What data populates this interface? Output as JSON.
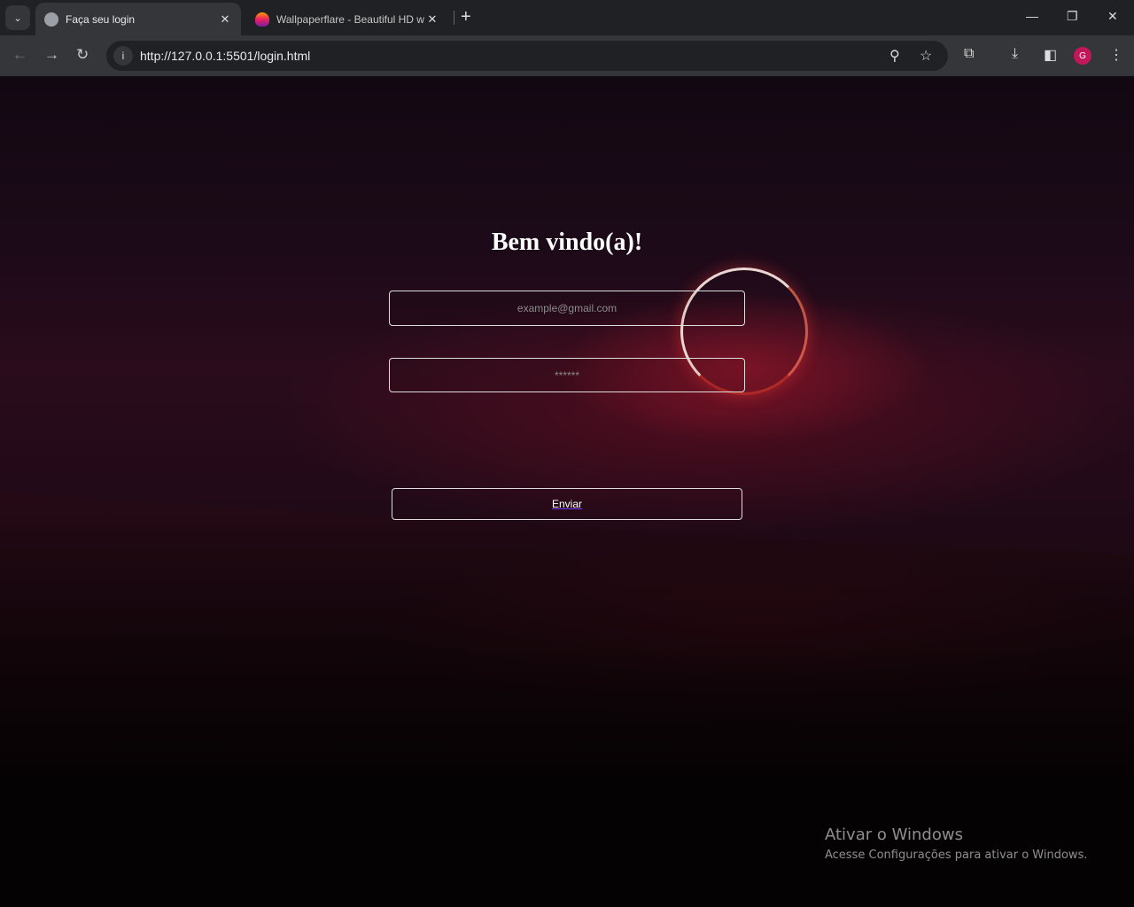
{
  "browser": {
    "tabs": [
      {
        "title": "Faça seu login",
        "icon": "globe-icon",
        "active": true
      },
      {
        "title": "Wallpaperflare - Beautiful HD w",
        "icon": "flame-icon",
        "active": false
      }
    ],
    "url": "http://127.0.0.1:5501/login.html",
    "profile_initial": "G"
  },
  "page": {
    "heading": "Bem vindo(a)!",
    "email_placeholder": "example@gmail.com",
    "password_placeholder": "******",
    "submit_label": "Enviar"
  },
  "watermark": {
    "title": "Ativar o Windows",
    "subtitle": "Acesse Configurações para ativar o Windows."
  },
  "colors": {
    "accent": "#7a3cff",
    "background": "#2a0c1c"
  }
}
